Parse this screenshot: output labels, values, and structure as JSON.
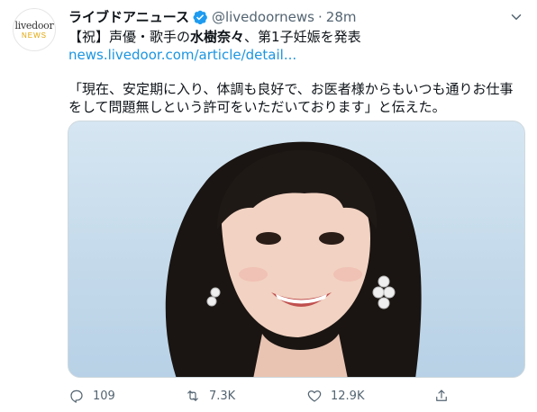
{
  "account": {
    "name": "ライブドアニュース",
    "handle": "@livedoornews",
    "separator": "·",
    "time": "28m",
    "avatar_logo": "livedoor",
    "avatar_sub": "NEWS"
  },
  "tweet": {
    "line1_prefix": "【祝】声優・歌手の",
    "line1_bold": "水樹奈々",
    "line1_suffix": "、第1子妊娠を発表",
    "link": "news.livedoor.com/article/detail...",
    "quote_line1": "「現在、安定期に入り、体調も良好で、お医者様からもいつも通りお仕事",
    "quote_line2": "をして問題無しという許可をいただいております」と伝えた。"
  },
  "actions": {
    "replies": "109",
    "retweets": "7.3K",
    "likes": "12.9K"
  },
  "icons": {
    "verified": "verified-badge-icon",
    "caret": "chevron-down-icon",
    "reply": "reply-icon",
    "retweet": "retweet-icon",
    "like": "heart-icon",
    "share": "share-icon"
  },
  "colors": {
    "text": "#0f1419",
    "secondary": "#536471",
    "link": "#1b95e0",
    "verified": "#1d9bf0"
  }
}
